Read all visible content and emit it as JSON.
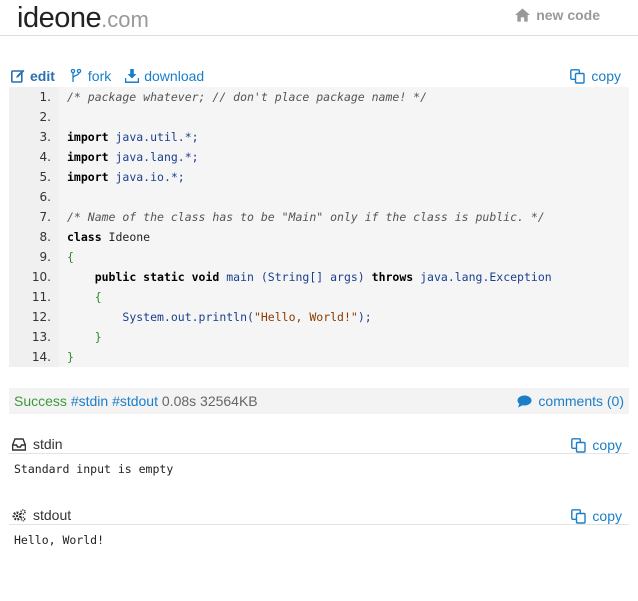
{
  "header": {
    "logo_main": "ideone",
    "logo_tld": ".com",
    "new_code_label": "new code"
  },
  "toolbar": {
    "edit_label": "edit",
    "fork_label": "fork",
    "download_label": "download",
    "copy_label": "copy"
  },
  "code": {
    "line_numbers": [
      "1.",
      "2.",
      "3.",
      "4.",
      "5.",
      "6.",
      "7.",
      "8.",
      "9.",
      "10.",
      "11.",
      "12.",
      "13.",
      "14."
    ],
    "lines": [
      [
        {
          "t": "/* package whatever; // don't place package name! */",
          "c": "cm"
        }
      ],
      [],
      [
        {
          "t": "import",
          "c": "kw"
        },
        {
          "t": " ",
          "c": ""
        },
        {
          "t": "java.util.*;",
          "c": "pk"
        }
      ],
      [
        {
          "t": "import",
          "c": "kw"
        },
        {
          "t": " ",
          "c": ""
        },
        {
          "t": "java.lang.*;",
          "c": "pk"
        }
      ],
      [
        {
          "t": "import",
          "c": "kw"
        },
        {
          "t": " ",
          "c": ""
        },
        {
          "t": "java.io.*;",
          "c": "pk"
        }
      ],
      [],
      [
        {
          "t": "/* Name of the class has to be \"Main\" only if the class is public. */",
          "c": "cm"
        }
      ],
      [
        {
          "t": "class",
          "c": "kw"
        },
        {
          "t": " Ideone",
          "c": ""
        }
      ],
      [
        {
          "t": "{",
          "c": "br"
        }
      ],
      [
        {
          "t": "    ",
          "c": ""
        },
        {
          "t": "public static void",
          "c": "kw"
        },
        {
          "t": " main ",
          "c": "pk"
        },
        {
          "t": "(String[] args) ",
          "c": "pk"
        },
        {
          "t": "throws",
          "c": "kw"
        },
        {
          "t": " java.lang.Exception",
          "c": "pk"
        }
      ],
      [
        {
          "t": "    ",
          "c": ""
        },
        {
          "t": "{",
          "c": "br"
        }
      ],
      [
        {
          "t": "        ",
          "c": ""
        },
        {
          "t": "System.out.println(",
          "c": "pk"
        },
        {
          "t": "\"Hello, World!\"",
          "c": "str"
        },
        {
          "t": ");",
          "c": "pk"
        }
      ],
      [
        {
          "t": "    ",
          "c": ""
        },
        {
          "t": "}",
          "c": "br"
        }
      ],
      [
        {
          "t": "}",
          "c": "br"
        }
      ]
    ]
  },
  "result": {
    "status": "Success",
    "tags": [
      "#stdin",
      "#stdout"
    ],
    "time": "0.08s",
    "memory": "32564KB",
    "comments_label": "comments (0)"
  },
  "stdin": {
    "title": "stdin",
    "copy_label": "copy",
    "content": "Standard input is empty"
  },
  "stdout": {
    "title": "stdout",
    "copy_label": "copy",
    "content": "Hello, World!"
  }
}
